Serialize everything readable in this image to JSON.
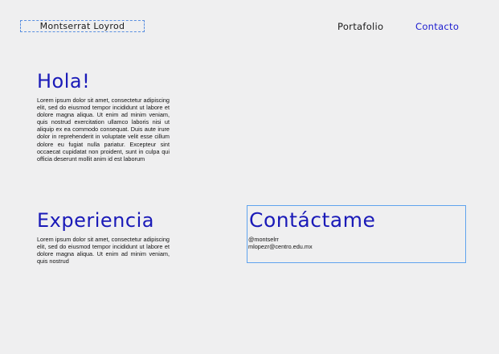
{
  "header": {
    "brand_name": "Montserrat Loyrod",
    "nav": {
      "portfolio_label": "Portafolio",
      "contact_label": "Contacto"
    }
  },
  "sections": {
    "hola": {
      "title": "Hola!",
      "body": "Lorem ipsum dolor sit amet, consectetur adipiscing elit, sed do eiusmod tempor incididunt ut labore et dolore magna aliqua. Ut enim ad minim veniam, quis nostrud exercitation ullamco laboris nisi ut aliquip ex ea commodo consequat. Duis aute irure dolor in reprehenderit in voluptate velit esse cillum dolore eu fugiat nulla pariatur. Excepteur sint occaecat cupidatat non proident, sunt in culpa qui officia deserunt mollit anim id est laborum"
    },
    "experiencia": {
      "title": "Experiencia",
      "body": "Lorem ipsum dolor sit amet, consectetur adipiscing elit, sed do eiusmod tempor incididunt ut labore et dolore magna aliqua. Ut enim ad minim veniam, quis nostrud"
    },
    "contactame": {
      "title": "Contáctame",
      "handle": "@montselrr",
      "email": "mlopezr@centro.edu.mx"
    }
  },
  "colors": {
    "background": "#efeff0",
    "heading": "#1a1ab8",
    "active_nav": "#1c1ccf",
    "selection_border": "#5fa3ee"
  }
}
